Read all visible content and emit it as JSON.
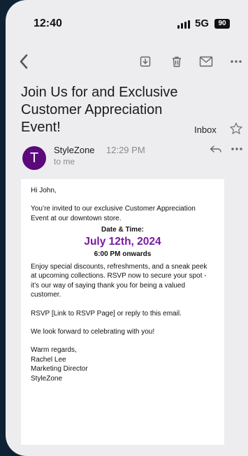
{
  "status_bar": {
    "time": "12:40",
    "network": "5G",
    "battery": "90"
  },
  "toolbar": {
    "icons": [
      "back-icon",
      "archive-icon",
      "trash-icon",
      "mail-icon",
      "more-icon"
    ]
  },
  "email": {
    "subject": "Join Us for and Exclusive Customer Appreciation Event!",
    "folder": "Inbox",
    "sender_initial": "T",
    "sender_name": "StyleZone",
    "sent_time": "12:29 PM",
    "recipient": "to me",
    "body": {
      "greeting": "Hi John,",
      "intro": "You’re invited to our exclusive Customer Appreciation Event at our downtown store.",
      "date_label": "Date & Time:",
      "date": "July 12th, 2024",
      "time": "6:00 PM onwards",
      "details": "Enjoy special discounts, refreshments, and a sneak peek at upcoming collections. RSVP now to secure your spot - it’s our way of saying thank you for being a valued customer.",
      "rsvp": "RSVP [Link to RSVP Page] or reply to this email.",
      "closing": "We look forward to celebrating with you!",
      "signoff": "Warm regards,",
      "signer_name": "Rachel Lee",
      "signer_title": "Marketing Director",
      "signer_company": "StyleZone"
    }
  },
  "colors": {
    "avatar": "#5a0a7a",
    "event_date": "#7a1aa0",
    "background": "#ededf0",
    "outer": "#0f2233"
  }
}
